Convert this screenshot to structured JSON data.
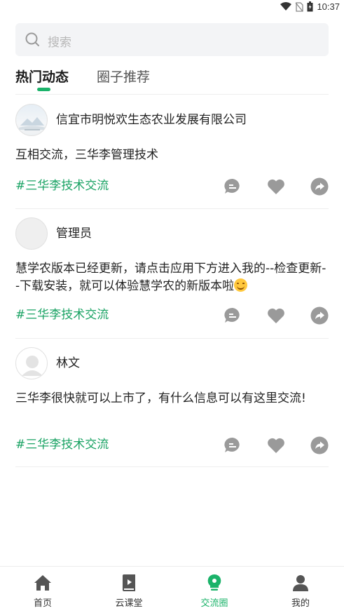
{
  "status_bar": {
    "time": "10:37"
  },
  "search": {
    "placeholder": "搜索"
  },
  "tabs": [
    {
      "label": "热门动态",
      "active": true
    },
    {
      "label": "圈子推荐",
      "active": false
    }
  ],
  "posts": [
    {
      "author": "信宜市明悦欢生态农业发展有限公司",
      "content": "互相交流，三华李管理技术",
      "topic": "#三华李技术交流"
    },
    {
      "author": "管理员",
      "content": "  慧学农版本已经更新，请点击应用下方进入我的--检查更新--下载安装，就可以体验慧学农的新版本啦",
      "topic": "#三华李技术交流"
    },
    {
      "author": "林文",
      "content": "三华李很快就可以上市了，有什么信息可以有这里交流!",
      "topic": "#三华李技术交流"
    }
  ],
  "bottom_nav": [
    {
      "label": "首页",
      "icon": "home-icon",
      "active": false
    },
    {
      "label": "云课堂",
      "icon": "book-icon",
      "active": false
    },
    {
      "label": "交流圈",
      "icon": "bulb-icon",
      "active": true
    },
    {
      "label": "我的",
      "icon": "user-icon",
      "active": false
    }
  ],
  "colors": {
    "accent": "#1bb36a",
    "topic": "#1aa364",
    "action_icon": "#9a9a9a"
  }
}
